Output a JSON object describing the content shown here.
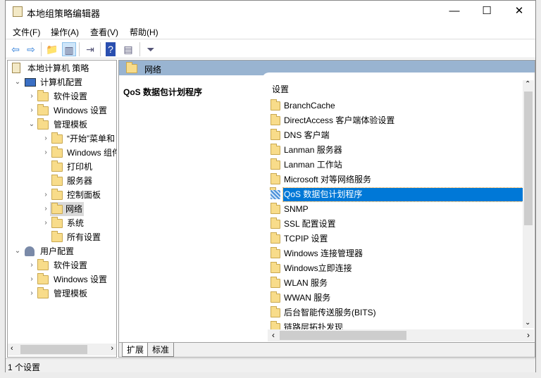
{
  "window": {
    "title": "本地组策略编辑器",
    "minimize": "—",
    "maximize": "☐",
    "close": "✕"
  },
  "menu": [
    "文件(F)",
    "操作(A)",
    "查看(V)",
    "帮助(H)"
  ],
  "toolbar": [
    {
      "icon": "back-icon",
      "glyph": "⇦"
    },
    {
      "icon": "forward-icon",
      "glyph": "⇨"
    },
    {
      "icon": "up-folder-icon",
      "glyph": "📁"
    },
    {
      "icon": "show-hide-tree-icon",
      "glyph": "▥"
    },
    {
      "icon": "export-list-icon",
      "glyph": "⇥"
    },
    {
      "icon": "help-icon",
      "glyph": "?"
    },
    {
      "icon": "show-hide-action-pane-icon",
      "glyph": "▤"
    },
    {
      "icon": "filter-icon",
      "glyph": "⏷"
    }
  ],
  "tree": [
    {
      "label": "本地计算机 策略",
      "level": 0,
      "chev": "",
      "icon": "policy"
    },
    {
      "label": "计算机配置",
      "level": 1,
      "chev": "⌄",
      "icon": "computer"
    },
    {
      "label": "软件设置",
      "level": 2,
      "chev": "›",
      "icon": "folder"
    },
    {
      "label": "Windows 设置",
      "level": 2,
      "chev": "›",
      "icon": "folder"
    },
    {
      "label": "管理模板",
      "level": 2,
      "chev": "⌄",
      "icon": "folder"
    },
    {
      "label": "“开始”菜单和",
      "level": 3,
      "chev": "›",
      "icon": "folder"
    },
    {
      "label": "Windows 组件",
      "level": 3,
      "chev": "›",
      "icon": "folder"
    },
    {
      "label": "打印机",
      "level": 3,
      "chev": "",
      "icon": "folder"
    },
    {
      "label": "服务器",
      "level": 3,
      "chev": "",
      "icon": "folder"
    },
    {
      "label": "控制面板",
      "level": 3,
      "chev": "›",
      "icon": "folder"
    },
    {
      "label": "网络",
      "level": 3,
      "chev": "›",
      "icon": "folder",
      "selected": true
    },
    {
      "label": "系统",
      "level": 3,
      "chev": "›",
      "icon": "folder"
    },
    {
      "label": "所有设置",
      "level": 3,
      "chev": "",
      "icon": "all-settings"
    },
    {
      "label": "用户配置",
      "level": 1,
      "chev": "⌄",
      "icon": "user"
    },
    {
      "label": "软件设置",
      "level": 2,
      "chev": "›",
      "icon": "folder"
    },
    {
      "label": "Windows 设置",
      "level": 2,
      "chev": "›",
      "icon": "folder"
    },
    {
      "label": "管理模板",
      "level": 2,
      "chev": "›",
      "icon": "folder"
    }
  ],
  "right": {
    "header": "网络",
    "description_title": "QoS 数据包计划程序",
    "column_header": "设置",
    "items": [
      "BranchCache",
      "DirectAccess 客户端体验设置",
      "DNS 客户端",
      "Lanman 服务器",
      "Lanman 工作站",
      "Microsoft 对等网络服务",
      "QoS 数据包计划程序",
      "SNMP",
      "SSL 配置设置",
      "TCPIP 设置",
      "Windows 连接管理器",
      "Windows立即连接",
      "WLAN 服务",
      "WWAN 服务",
      "后台智能传送服务(BITS)",
      "链路层拓扑发现"
    ],
    "selected_index": 6,
    "tabs": [
      "扩展",
      "标准"
    ],
    "active_tab": "扩展"
  },
  "status": "1 个设置",
  "colors": {
    "header_band": "#99b4d1",
    "selection": "#0078d7"
  }
}
